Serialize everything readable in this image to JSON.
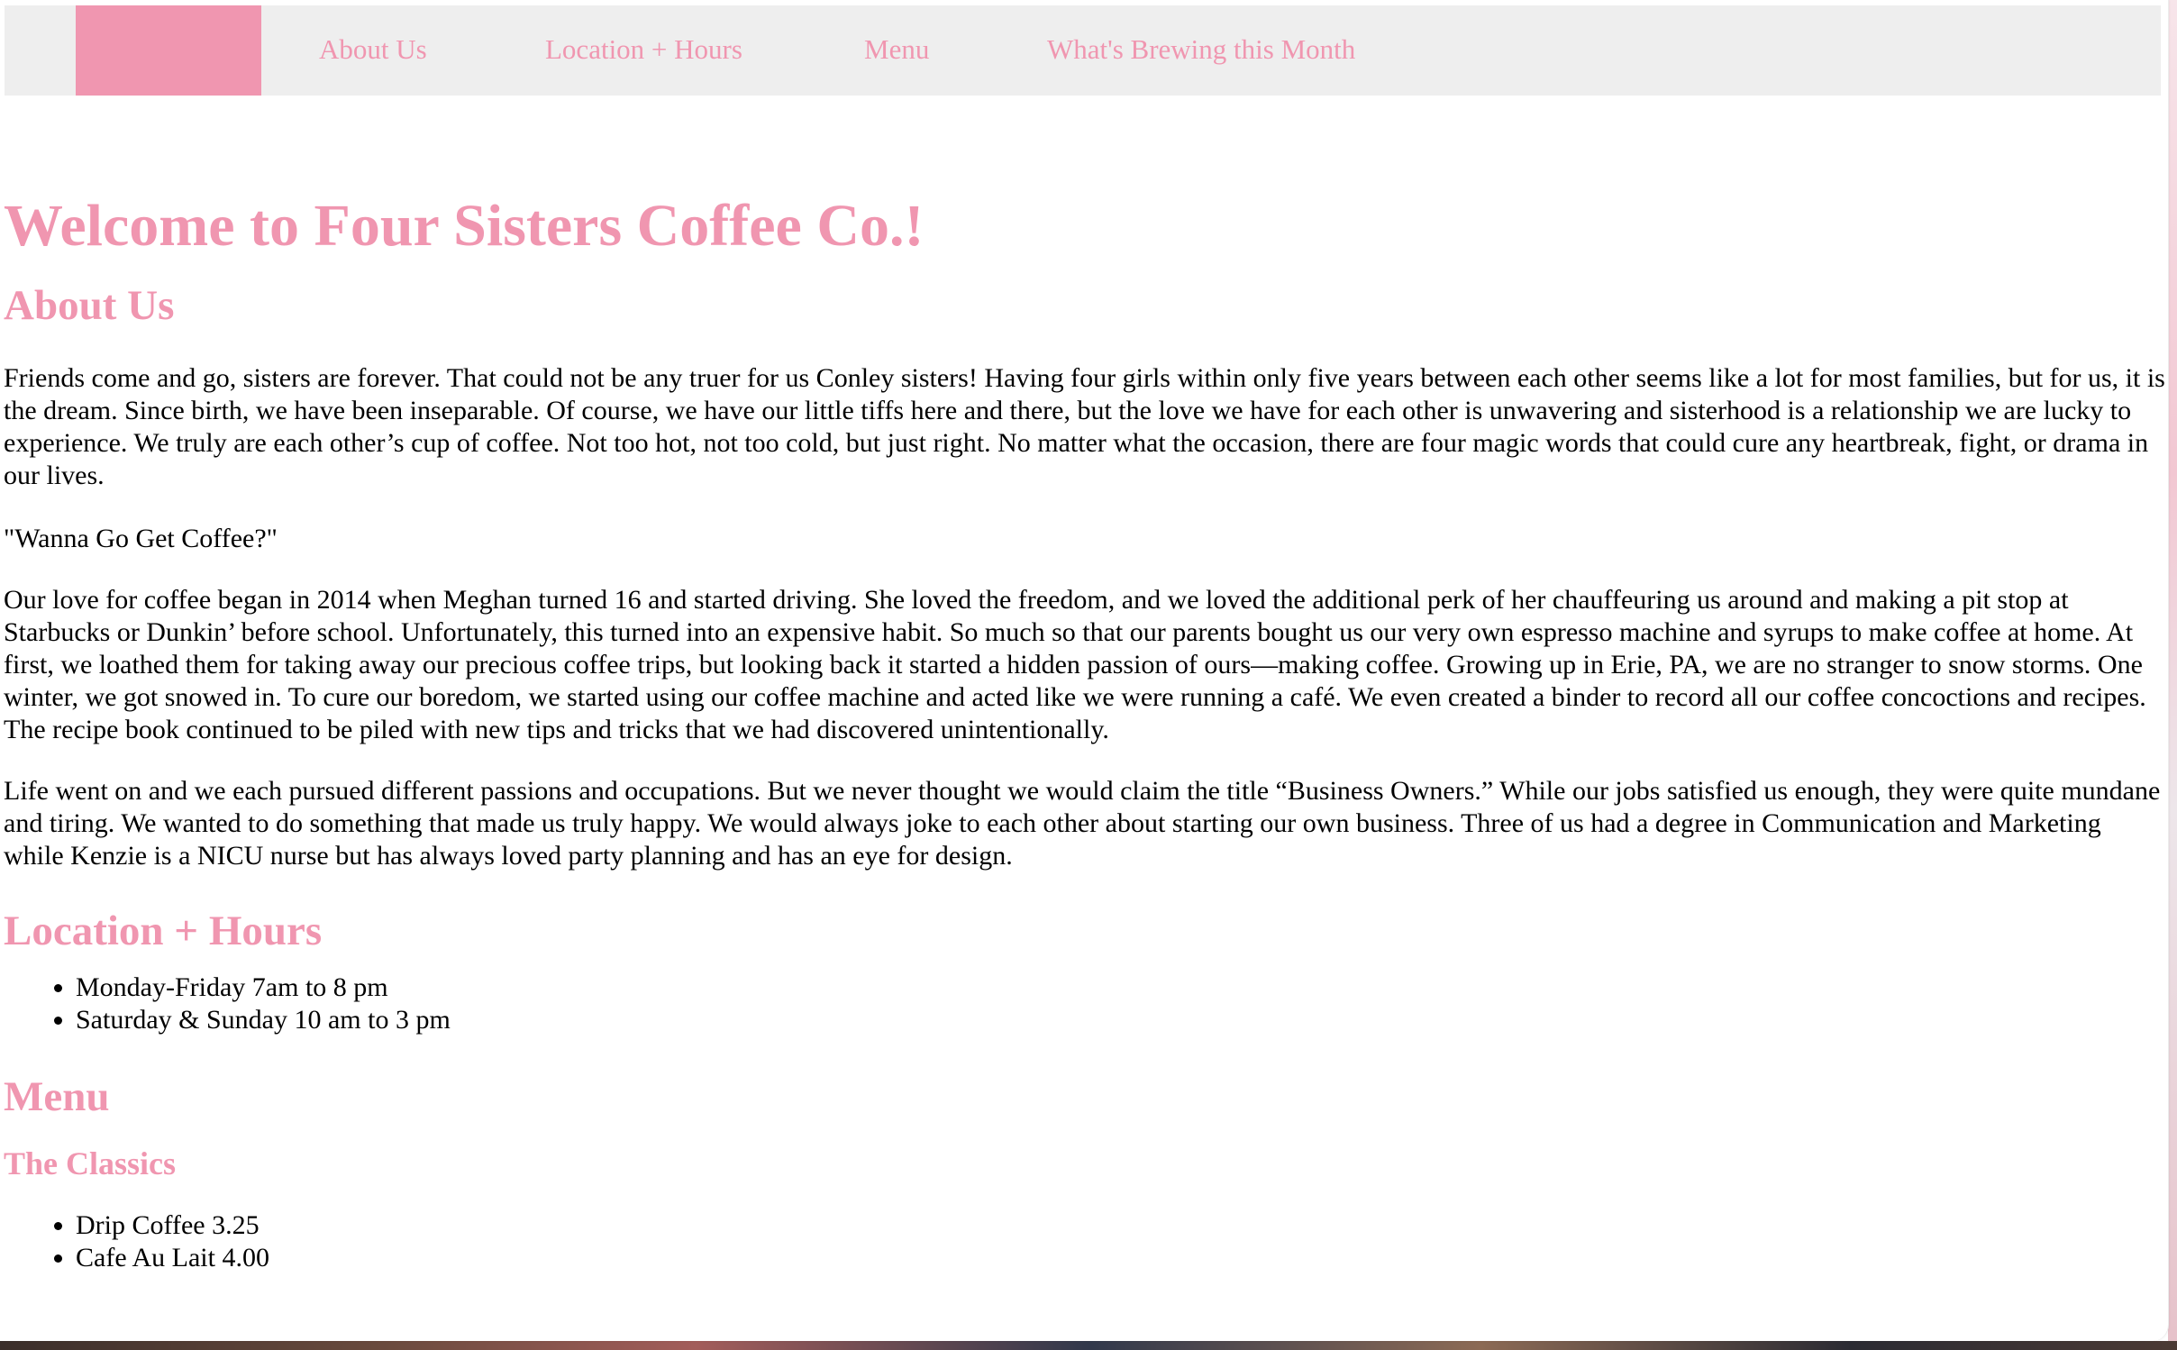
{
  "nav": {
    "home_label": "",
    "items": [
      {
        "label": "About Us"
      },
      {
        "label": "Location + Hours"
      },
      {
        "label": "Menu"
      },
      {
        "label": "What's Brewing this Month"
      }
    ]
  },
  "main": {
    "title": "Welcome to Four Sisters Coffee Co.!",
    "about": {
      "heading": "About Us",
      "paragraphs": [
        "Friends come and go, sisters are forever. That could not be any truer for us Conley sisters! Having four girls within only five years between each other seems like a lot for most families, but for us, it is the dream. Since birth, we have been inseparable. Of course, we have our little tiffs here and there, but the love we have for each other is unwavering and sisterhood is a relationship we are lucky to experience. We truly are each other’s cup of coffee. Not too hot, not too cold, but just right. No matter what the occasion, there are four magic words that could cure any heartbreak, fight, or drama in our lives.",
        "\"Wanna Go Get Coffee?\"",
        "Our love for coffee began in 2014 when Meghan turned 16 and started driving. She loved the freedom, and we loved the additional perk of her chauffeuring us around and making a pit stop at Starbucks or Dunkin’ before school. Unfortunately, this turned into an expensive habit. So much so that our parents bought us our very own espresso machine and syrups to make coffee at home. At first, we loathed them for taking away our precious coffee trips, but looking back it started a hidden passion of ours—making coffee. Growing up in Erie, PA, we are no stranger to snow storms. One winter, we got snowed in. To cure our boredom, we started using our coffee machine and acted like we were running a café. We even created a binder to record all our coffee concoctions and recipes. The recipe book continued to be piled with new tips and tricks that we had discovered unintentionally.",
        "Life went on and we each pursued different passions and occupations. But we never thought we would claim the title “Business Owners.” While our jobs satisfied us enough, they were quite mundane and tiring. We wanted to do something that made us truly happy. We would always joke to each other about starting our own business. Three of us had a degree in Communication and Marketing while Kenzie is a NICU nurse but has always loved party planning and has an eye for design."
      ]
    },
    "location": {
      "heading": "Location + Hours",
      "hours": [
        "Monday-Friday 7am to 8 pm",
        "Saturday & Sunday 10 am to 3 pm"
      ]
    },
    "menu": {
      "heading": "Menu",
      "classics_heading": "The Classics",
      "classics": [
        "Drip Coffee 3.25",
        "Cafe Au Lait 4.00"
      ]
    }
  },
  "colors": {
    "accent": "#f096b0",
    "nav_background": "#eeeeee",
    "text": "#000000",
    "page_background": "#ffffff"
  }
}
